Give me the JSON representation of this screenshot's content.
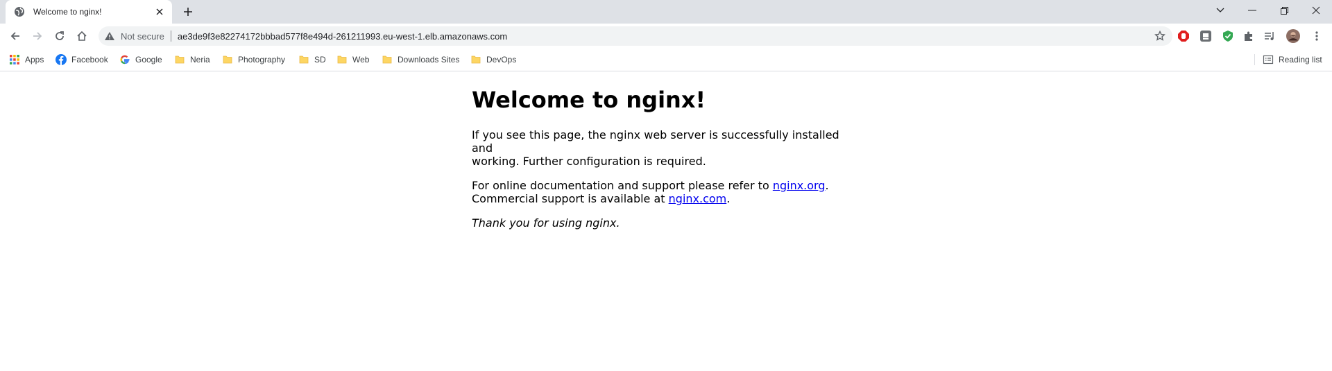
{
  "tab": {
    "title": "Welcome to nginx!"
  },
  "address_bar": {
    "security_label": "Not secure",
    "url": "ae3de9f3e82274172bbbad577f8e494d-261211993.eu-west-1.elb.amazonaws.com"
  },
  "bookmarks": [
    {
      "label": "Apps",
      "icon": "apps-grid-icon"
    },
    {
      "label": "Facebook",
      "icon": "facebook-icon"
    },
    {
      "label": "Google",
      "icon": "google-icon"
    },
    {
      "label": "Neria",
      "icon": "folder-icon"
    },
    {
      "label": "Photography",
      "icon": "folder-icon"
    },
    {
      "label": "SD",
      "icon": "folder-icon"
    },
    {
      "label": "Web",
      "icon": "folder-icon"
    },
    {
      "label": "Downloads Sites",
      "icon": "folder-icon"
    },
    {
      "label": "DevOps",
      "icon": "folder-icon"
    }
  ],
  "reading_list": "Reading list",
  "page": {
    "heading": "Welcome to nginx!",
    "p1_line1": "If you see this page, the nginx web server is successfully installed and",
    "p1_line2": "working. Further configuration is required.",
    "p2_text1": "For online documentation and support please refer to ",
    "p2_link1": "nginx.org",
    "p2_text2": ".",
    "p2_text3": "Commercial support is available at ",
    "p2_link2": "nginx.com",
    "p2_text4": ".",
    "thanks": "Thank you for using nginx."
  },
  "colors": {
    "tabstrip": "#dee1e6",
    "link": "#0000ee",
    "folder": "#fdd663"
  }
}
